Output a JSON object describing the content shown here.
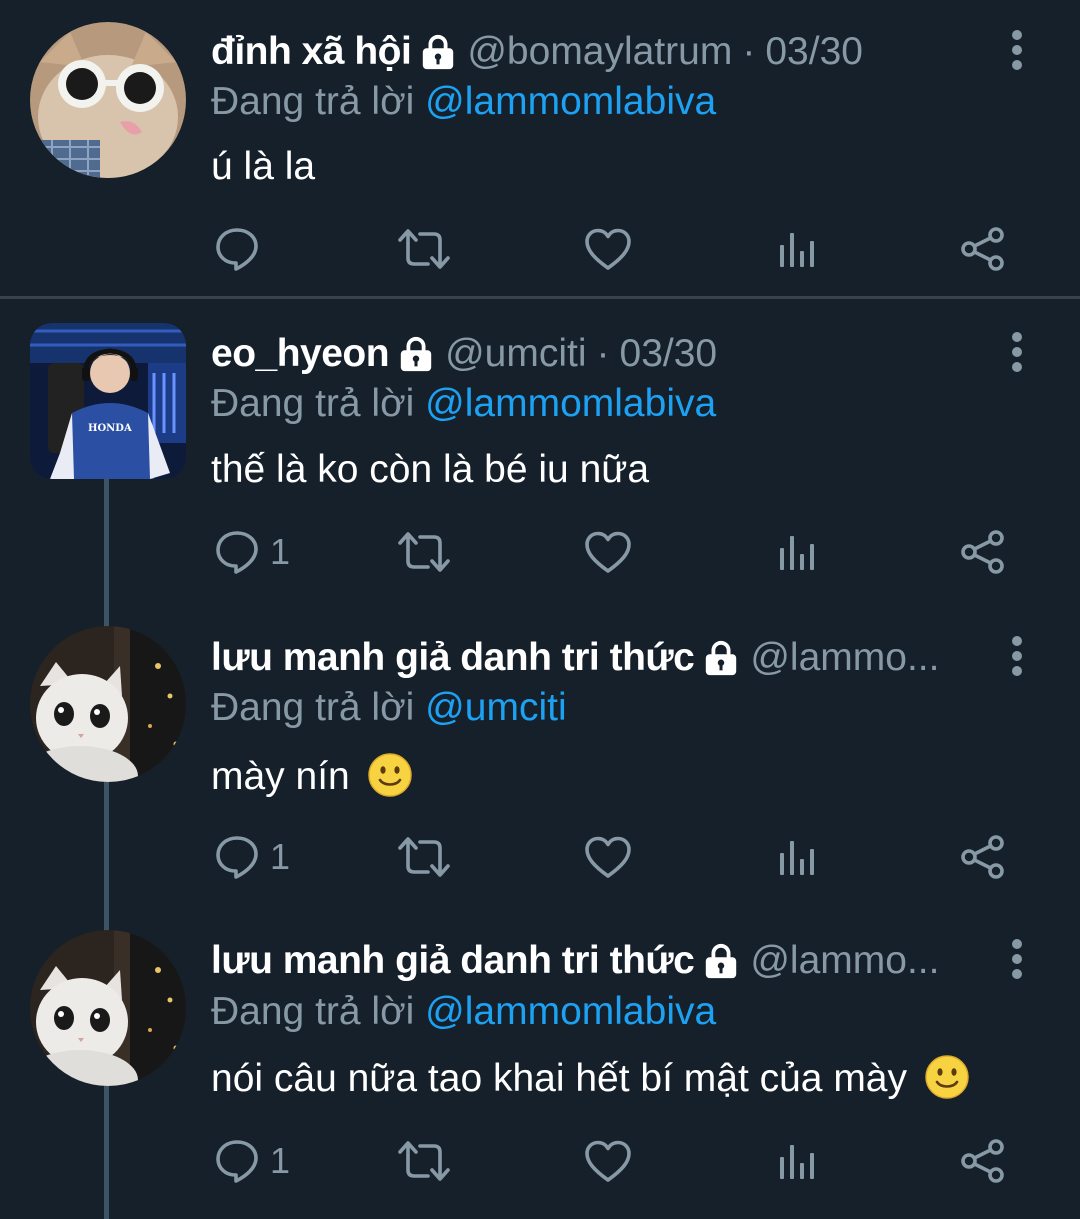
{
  "colors": {
    "background": "#15202b",
    "text": "#ffffff",
    "muted": "#8899a6",
    "mention": "#1da1f2",
    "divider": "#38444d",
    "thread_line": "#3d5466"
  },
  "tweets": [
    {
      "name": "đỉnh xã hội",
      "handle": "@bomaylatrum",
      "separator": "·",
      "date": "03/30",
      "reply_prefix": "Đang trả lời",
      "reply_to": "@lammomlabiva",
      "text": "ú là la",
      "reply_count": "",
      "avatar": "cat-with-sunglasses-avatar"
    },
    {
      "name": "eo_hyeon",
      "handle": "@umciti",
      "separator": "·",
      "date": "03/30",
      "reply_prefix": "Đang trả lời",
      "reply_to": "@lammomlabiva",
      "text": "thế là ko còn là bé iu nữa",
      "reply_count": "1",
      "avatar": "esports-player-photo-avatar",
      "avatar_jersey_text": "HONDA"
    },
    {
      "name": "lưu manh giả danh tri thức",
      "handle": "@lammo...",
      "reply_prefix": "Đang trả lời",
      "reply_to": "@umciti",
      "text": "mày nín",
      "emoji": "slightly-smiling-face-emoji",
      "reply_count": "1",
      "avatar": "white-cat-avatar"
    },
    {
      "name": "lưu manh giả danh tri thức",
      "handle": "@lammo...",
      "reply_prefix": "Đang trả lời",
      "reply_to": "@lammomlabiva",
      "text": "nói câu nữa tao khai hết bí mật của mày",
      "emoji": "slightly-smiling-face-emoji",
      "reply_count": "1",
      "avatar": "white-cat-avatar"
    }
  ],
  "icons": {
    "lock": "lock-icon",
    "more": "more-vertical-icon",
    "reply": "reply-bubble-icon",
    "retweet": "retweet-icon",
    "like": "heart-icon",
    "analytics": "bar-chart-icon",
    "share": "share-icon"
  }
}
